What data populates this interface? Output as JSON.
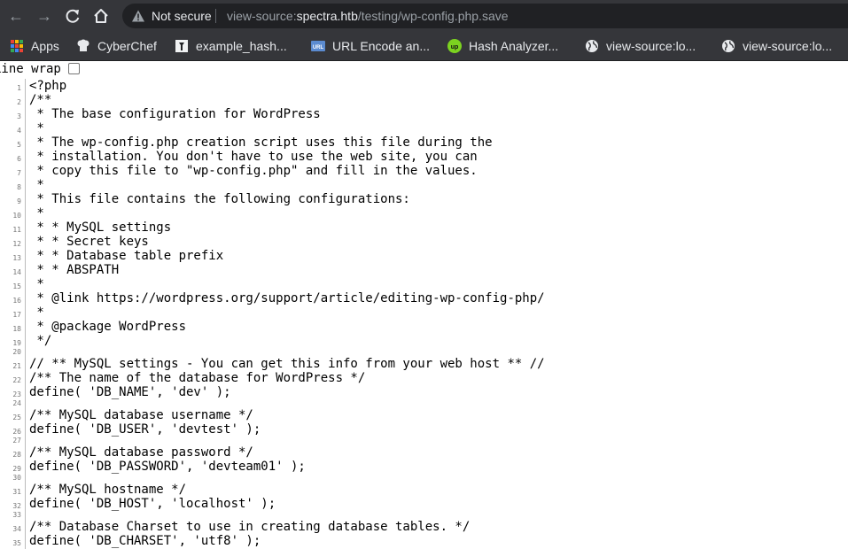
{
  "browser": {
    "not_secure_label": "Not secure",
    "url_prefix": "view-source:",
    "url_host": "spectra.htb",
    "url_path": "/testing/wp-config.php.save"
  },
  "bookmarks": [
    {
      "label": "Apps",
      "icon": "apps-grid-icon"
    },
    {
      "label": "CyberChef",
      "icon": "cyberchef-icon"
    },
    {
      "label": "example_hash...",
      "icon": "bookmark-page-icon"
    },
    {
      "label": "URL Encode an...",
      "icon": "url-encode-icon"
    },
    {
      "label": "Hash Analyzer...",
      "icon": "hash-analyzer-icon"
    },
    {
      "label": "view-source:lo...",
      "icon": "globe-icon"
    },
    {
      "label": "view-source:lo...",
      "icon": "globe-icon"
    }
  ],
  "line_wrap_label": "Line wrap",
  "source_lines": [
    {
      "num": "1",
      "text": "<?php"
    },
    {
      "num": "2",
      "text": "/**"
    },
    {
      "num": "3",
      "text": " * The base configuration for WordPress"
    },
    {
      "num": "4",
      "text": " *"
    },
    {
      "num": "5",
      "text": " * The wp-config.php creation script uses this file during the"
    },
    {
      "num": "6",
      "text": " * installation. You don't have to use the web site, you can"
    },
    {
      "num": "7",
      "text": " * copy this file to \"wp-config.php\" and fill in the values."
    },
    {
      "num": "8",
      "text": " *"
    },
    {
      "num": "9",
      "text": " * This file contains the following configurations:"
    },
    {
      "num": "10",
      "text": " *"
    },
    {
      "num": "11",
      "text": " * * MySQL settings"
    },
    {
      "num": "12",
      "text": " * * Secret keys"
    },
    {
      "num": "13",
      "text": " * * Database table prefix"
    },
    {
      "num": "14",
      "text": " * * ABSPATH"
    },
    {
      "num": "15",
      "text": " *"
    },
    {
      "num": "16",
      "text": " * @link https://wordpress.org/support/article/editing-wp-config-php/"
    },
    {
      "num": "17",
      "text": " *"
    },
    {
      "num": "18",
      "text": " * @package WordPress"
    },
    {
      "num": "19",
      "text": " */"
    },
    {
      "num": "20",
      "text": ""
    },
    {
      "num": "21",
      "text": "// ** MySQL settings - You can get this info from your web host ** //"
    },
    {
      "num": "22",
      "text": "/** The name of the database for WordPress */"
    },
    {
      "num": "23",
      "text": "define( 'DB_NAME', 'dev' );"
    },
    {
      "num": "24",
      "text": ""
    },
    {
      "num": "25",
      "text": "/** MySQL database username */"
    },
    {
      "num": "26",
      "text": "define( 'DB_USER', 'devtest' );"
    },
    {
      "num": "27",
      "text": ""
    },
    {
      "num": "28",
      "text": "/** MySQL database password */"
    },
    {
      "num": "29",
      "text": "define( 'DB_PASSWORD', 'devteam01' );"
    },
    {
      "num": "30",
      "text": ""
    },
    {
      "num": "31",
      "text": "/** MySQL hostname */"
    },
    {
      "num": "32",
      "text": "define( 'DB_HOST', 'localhost' );"
    },
    {
      "num": "33",
      "text": ""
    },
    {
      "num": "34",
      "text": "/** Database Charset to use in creating database tables. */"
    },
    {
      "num": "35",
      "text": "define( 'DB_CHARSET', 'utf8' );"
    }
  ]
}
